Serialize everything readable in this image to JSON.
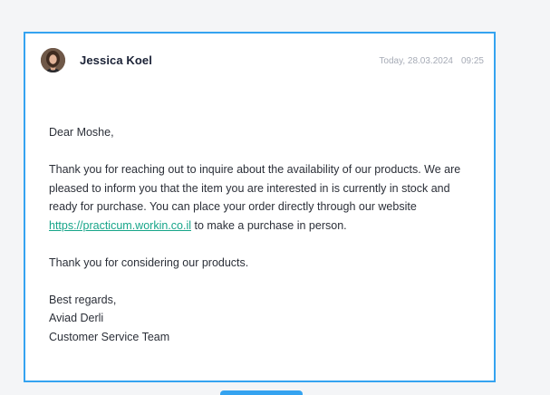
{
  "email": {
    "sender_name": "Jessica Koel",
    "date": "Today, 28.03.2024",
    "time": "09:25",
    "greeting": "Dear Moshe,",
    "paragraph_before_link": "Thank you for reaching out to inquire about the availability of our products. We are pleased to inform you that the item you are interested in is currently in stock and ready for purchase. You can place your order directly through our website ",
    "link_text": "https://practicum.workin.co.il",
    "paragraph_after_link": " to make a purchase in person.",
    "thanks": "Thank you for considering our products.",
    "signoff": "Best regards,",
    "signature_name": "Aviad Derli",
    "signature_team": "Customer Service Team"
  },
  "colors": {
    "card_border": "#35a3f0",
    "link": "#17a589",
    "sender_name": "#1b2236",
    "timestamp": "#a6abb6"
  },
  "icons": {
    "avatar": "sender-avatar-photo"
  }
}
